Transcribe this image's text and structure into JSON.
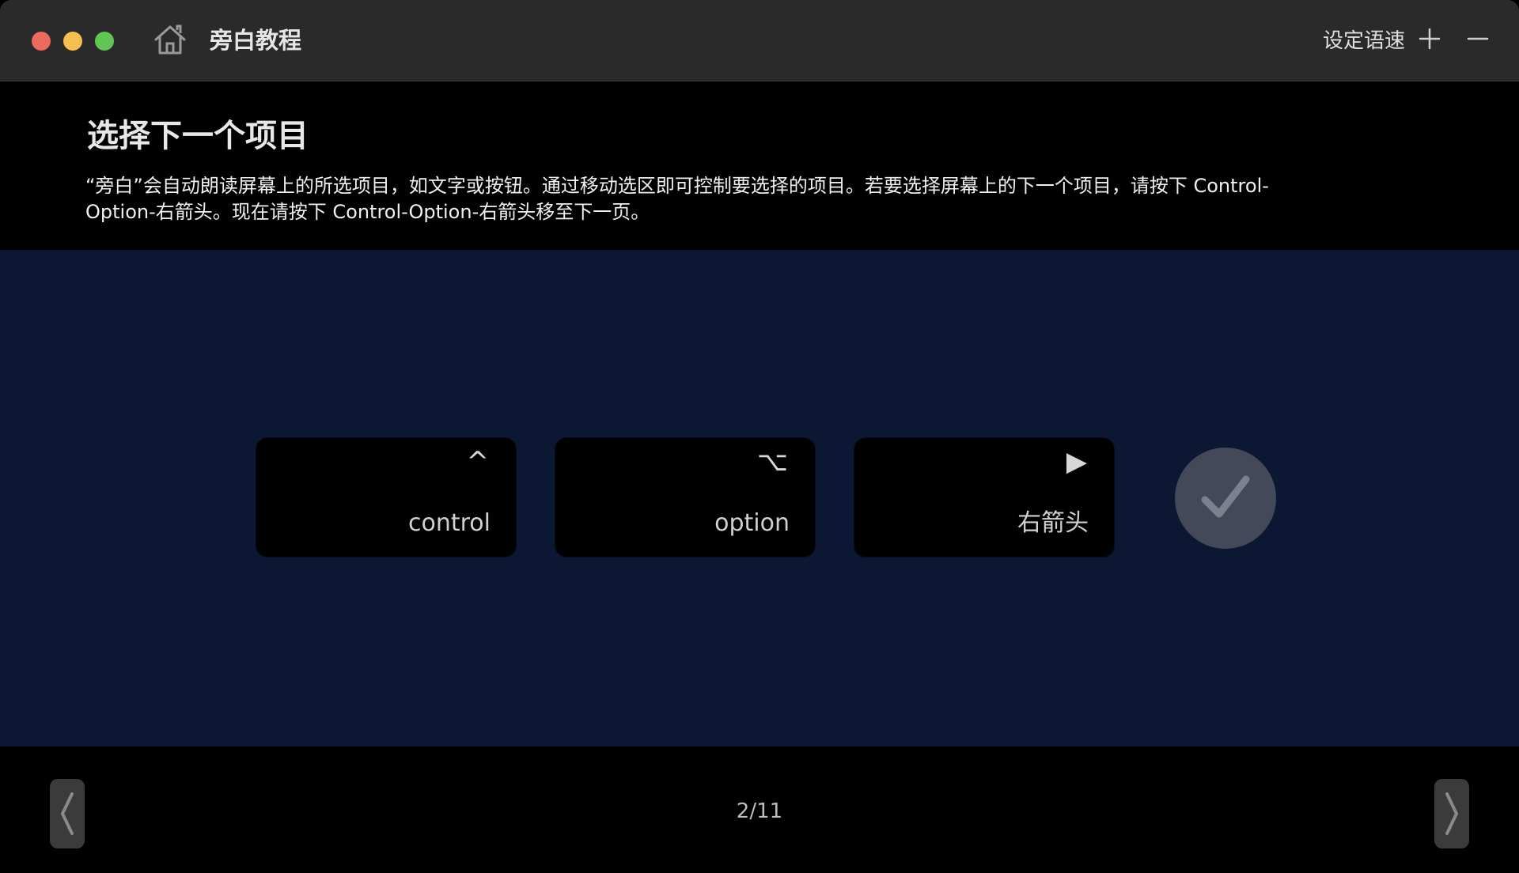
{
  "window": {
    "title": "旁白教程",
    "speed_label": "设定语速",
    "controls": [
      "close-button",
      "minimize-button",
      "zoom-button"
    ]
  },
  "header": {
    "title": "选择下一个项目",
    "instruction": "“旁白”会自动朗读屏幕上的所选项目，如文字或按钮。通过移动选区即可控制要选择的项目。若要选择屏幕上的下一个项目，请按下 Control-Option-右箭头。现在请按下 Control-Option-右箭头移至下一页。"
  },
  "keys": [
    {
      "symbol": "^",
      "label": "control"
    },
    {
      "symbol": "⌥",
      "label": "option"
    },
    {
      "symbol": "▶",
      "label": "右箭头"
    }
  ],
  "status": {
    "icon": "checkmark-icon"
  },
  "footer": {
    "page_indicator": "2/11"
  },
  "colors": {
    "titlebar": "#2a2a2a",
    "stage": "#0c1733",
    "key": "#000000",
    "check_circle": "#44495a"
  }
}
